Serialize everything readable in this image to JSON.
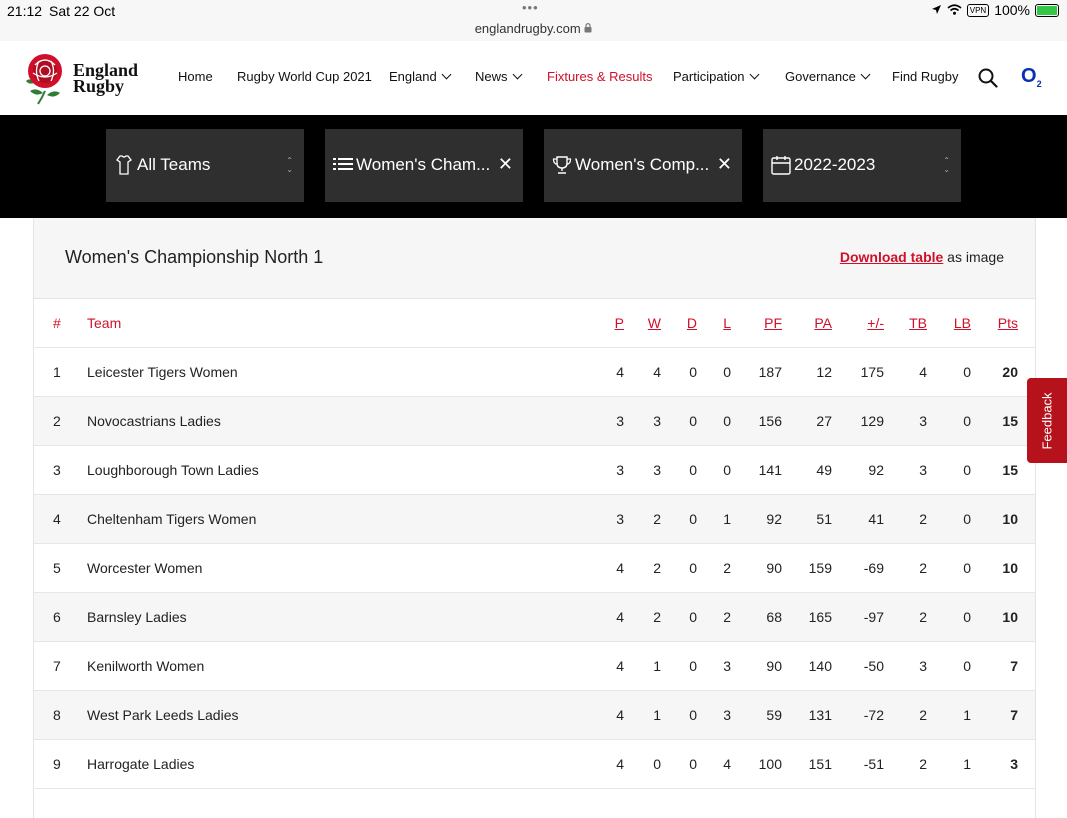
{
  "status": {
    "time": "21:12",
    "date": "Sat 22 Oct",
    "url": "englandrugby.com",
    "vpn": "VPN",
    "battery": "100%"
  },
  "logo": {
    "line1": "England",
    "line2": "Rugby"
  },
  "nav": {
    "items": [
      {
        "label": "Home"
      },
      {
        "label": "Rugby World Cup 2021"
      },
      {
        "label": "England"
      },
      {
        "label": "News"
      },
      {
        "label": "Fixtures & Results"
      },
      {
        "label": "Participation"
      },
      {
        "label": "Governance"
      },
      {
        "label": "Find Rugby"
      }
    ],
    "sponsor": "O",
    "sponsor_sub": "2"
  },
  "filters": [
    {
      "label": "All Teams",
      "icon": "shirt-icon"
    },
    {
      "label": "Women's Cham...",
      "icon": "list-icon"
    },
    {
      "label": "Women's Comp...",
      "icon": "trophy-icon"
    },
    {
      "label": "2022-2023",
      "icon": "calendar-icon"
    }
  ],
  "table": {
    "title": "Women's Championship North 1",
    "download_link": "Download table",
    "download_suffix": " as image",
    "headers": [
      "#",
      "Team",
      "P",
      "W",
      "D",
      "L",
      "PF",
      "PA",
      "+/-",
      "TB",
      "LB",
      "Pts"
    ],
    "rows": [
      [
        "1",
        "Leicester Tigers Women",
        "4",
        "4",
        "0",
        "0",
        "187",
        "12",
        "175",
        "4",
        "0",
        "20"
      ],
      [
        "2",
        "Novocastrians Ladies",
        "3",
        "3",
        "0",
        "0",
        "156",
        "27",
        "129",
        "3",
        "0",
        "15"
      ],
      [
        "3",
        "Loughborough Town Ladies",
        "3",
        "3",
        "0",
        "0",
        "141",
        "49",
        "92",
        "3",
        "0",
        "15"
      ],
      [
        "4",
        "Cheltenham Tigers Women",
        "3",
        "2",
        "0",
        "1",
        "92",
        "51",
        "41",
        "2",
        "0",
        "10"
      ],
      [
        "5",
        "Worcester Women",
        "4",
        "2",
        "0",
        "2",
        "90",
        "159",
        "-69",
        "2",
        "0",
        "10"
      ],
      [
        "6",
        "Barnsley Ladies",
        "4",
        "2",
        "0",
        "2",
        "68",
        "165",
        "-97",
        "2",
        "0",
        "10"
      ],
      [
        "7",
        "Kenilworth Women",
        "4",
        "1",
        "0",
        "3",
        "90",
        "140",
        "-50",
        "3",
        "0",
        "7"
      ],
      [
        "8",
        "West Park Leeds Ladies",
        "4",
        "1",
        "0",
        "3",
        "59",
        "131",
        "-72",
        "2",
        "1",
        "7"
      ],
      [
        "9",
        "Harrogate Ladies",
        "4",
        "0",
        "0",
        "4",
        "100",
        "151",
        "-51",
        "2",
        "1",
        "3"
      ]
    ]
  },
  "feedback": "Feedback",
  "colors": {
    "accent": "#d0102a",
    "filter_bg": "#2f2f2f",
    "bar_bg": "#000000"
  }
}
